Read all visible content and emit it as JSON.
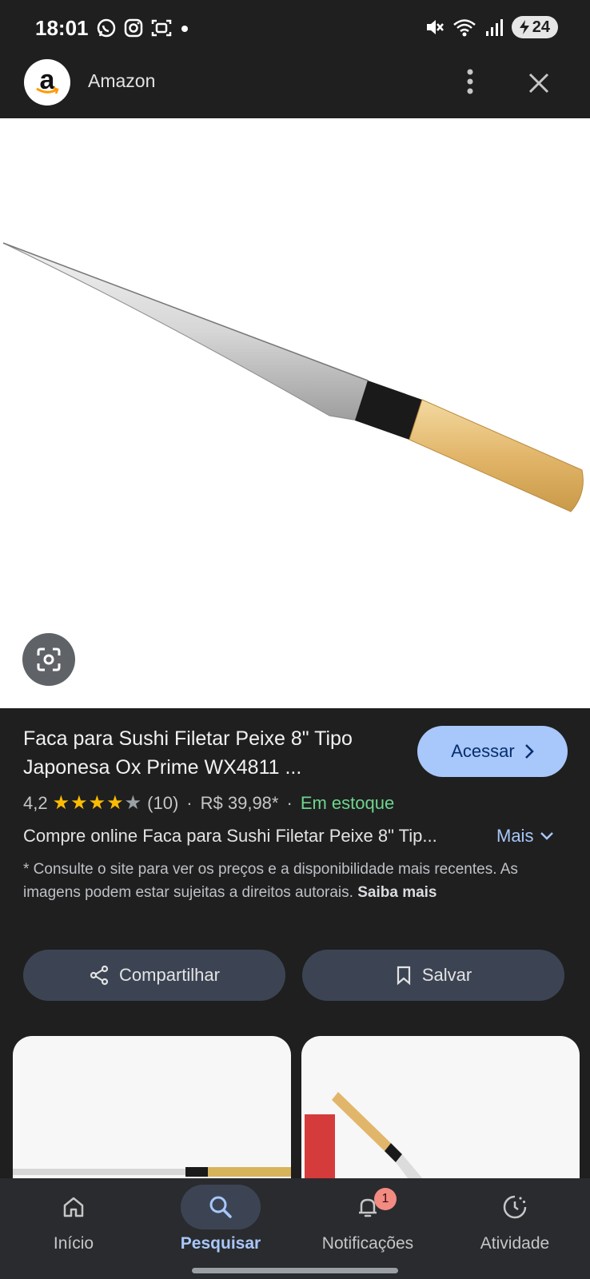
{
  "status_bar": {
    "time": "18:01",
    "battery_level": "24",
    "left_icons": [
      "whatsapp-icon",
      "instagram-icon",
      "screenshot-icon",
      "dot-icon"
    ],
    "right_icons": [
      "mute-icon",
      "wifi-icon",
      "signal-icon",
      "battery-icon"
    ]
  },
  "header": {
    "site_name": "Amazon",
    "logo_letter": "a"
  },
  "product": {
    "title": "Faca para Sushi Filetar Peixe 8\" Tipo Japonesa Ox Prime WX4811 ...",
    "rating": "4,2",
    "stars_filled": 4,
    "stars_total": 5,
    "reviews": "(10)",
    "price": "R$ 39,98*",
    "stock": "Em estoque",
    "description": "Compre online Faca para Sushi Filetar Peixe 8\" Tip...",
    "more_label": "Mais",
    "disclaimer": "* Consulte o site para ver os preços e a disponibilidade mais recentes. As imagens podem estar sujeitas a direitos autorais.",
    "learn_more": "Saiba mais"
  },
  "buttons": {
    "visit": "Acessar",
    "share": "Compartilhar",
    "save": "Salvar"
  },
  "bottom_nav": {
    "items": [
      {
        "label": "Início",
        "icon": "home-icon"
      },
      {
        "label": "Pesquisar",
        "icon": "search-icon"
      },
      {
        "label": "Notificações",
        "icon": "bell-icon",
        "badge": "1"
      },
      {
        "label": "Atividade",
        "icon": "activity-icon"
      }
    ],
    "active_index": 1
  },
  "colors": {
    "background": "#1f1f1f",
    "accent": "#a8c7fa",
    "stock_green": "#6dd58c",
    "star_yellow": "#fbbc04"
  }
}
